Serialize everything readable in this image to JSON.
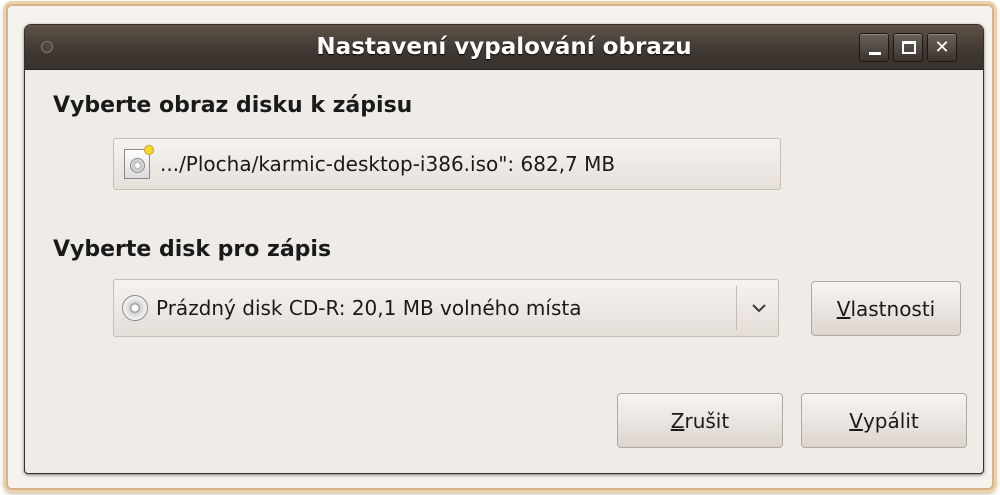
{
  "window": {
    "title": "Nastavení vypalování obrazu",
    "accent_color": "#3f3731",
    "controls": [
      "minimize-icon",
      "maximize-icon",
      "close-icon"
    ],
    "close_glyph": "✕"
  },
  "image_section": {
    "heading": "Vyberte obraz disku k zápisu",
    "file_icon": "disc-image-file-icon",
    "file_text": ".../Plocha/karmic-desktop-i386.iso\": 682,7 MB"
  },
  "disc_section": {
    "heading": "Vyberte disk pro zápis",
    "disc_icon": "cd-icon",
    "selected_disc": "Prázdný disk CD-R: 20,1 MB volného místa",
    "properties_mnemonic": "V",
    "properties_rest": "lastnosti"
  },
  "actions": {
    "cancel_mnemonic": "Z",
    "cancel_rest": "rušit",
    "burn_mnemonic": "V",
    "burn_rest": "ypálit"
  }
}
